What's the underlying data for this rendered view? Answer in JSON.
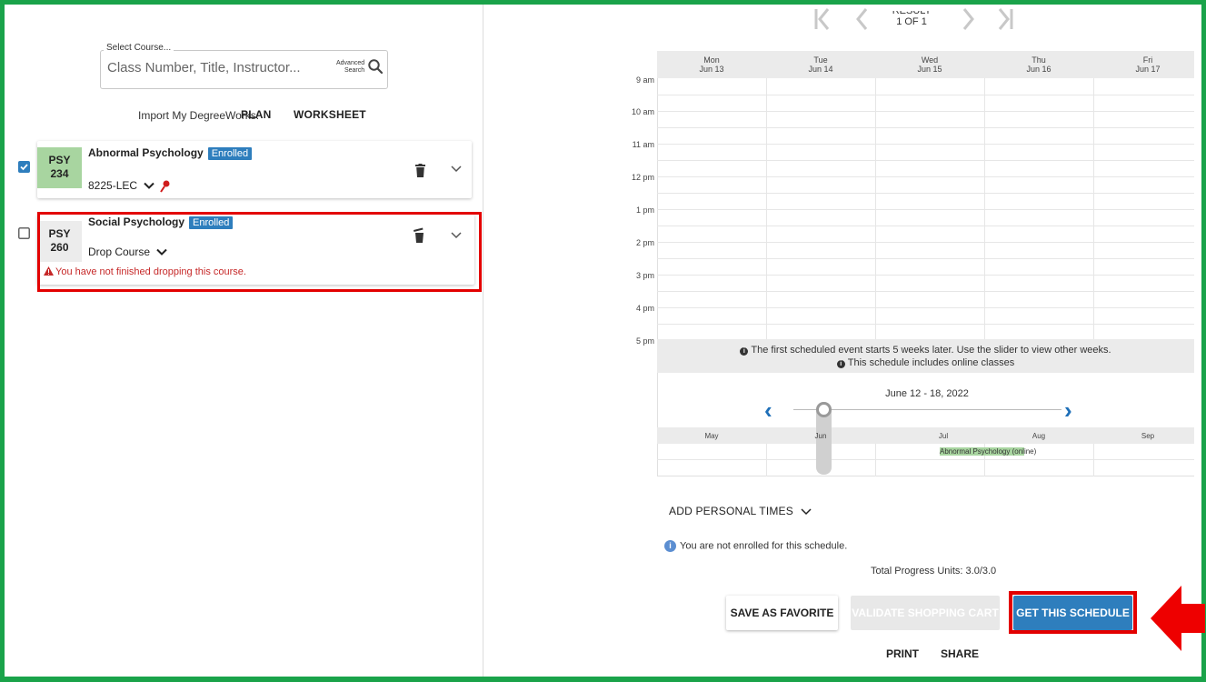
{
  "search": {
    "legend": "Select Course...",
    "placeholder": "Class Number, Title, Instructor...",
    "advanced_line1": "Advanced",
    "advanced_line2": "Search"
  },
  "import": {
    "label": "Import My DegreeWorks:",
    "plan": "PLAN",
    "worksheet": "WORKSHEET"
  },
  "courses": [
    {
      "subject": "PSY",
      "number": "234",
      "title": "Abnormal Psychology",
      "badge": "Enrolled",
      "section": "8225-LEC",
      "checked": true
    },
    {
      "subject": "PSY",
      "number": "260",
      "title": "Social Psychology",
      "badge": "Enrolled",
      "section": "Drop Course",
      "checked": false,
      "warning": "You have not finished dropping this course."
    }
  ],
  "pager": {
    "line1": "RESULT",
    "line2": "1 OF 1"
  },
  "calendar": {
    "days": [
      {
        "dow": "Mon",
        "date": "Jun 13"
      },
      {
        "dow": "Tue",
        "date": "Jun 14"
      },
      {
        "dow": "Wed",
        "date": "Jun 15"
      },
      {
        "dow": "Thu",
        "date": "Jun 16"
      },
      {
        "dow": "Fri",
        "date": "Jun 17"
      }
    ],
    "times": [
      "9 am",
      "10 am",
      "11 am",
      "12 pm",
      "1 pm",
      "2 pm",
      "3 pm",
      "4 pm",
      "5 pm"
    ],
    "notice_line1": "The first scheduled event starts 5 weeks later. Use the slider to view other weeks.",
    "notice_line2": "This schedule includes online classes",
    "week_range": "June 12 - 18, 2022",
    "months": [
      "May",
      "Jun",
      "Jul",
      "Aug",
      "Sep"
    ],
    "online_course_a": "Abnormal Psychology (onl",
    "online_course_b": "ine)"
  },
  "personal_times": "ADD PERSONAL TIMES",
  "info_text": "You are not enrolled for this schedule.",
  "units_text": "Total Progress Units: 3.0/3.0",
  "buttons": {
    "favorite": "SAVE AS FAVORITE",
    "validate": "VALIDATE SHOPPING CART",
    "get": "GET THIS SCHEDULE"
  },
  "links": {
    "print": "PRINT",
    "share": "SHARE"
  },
  "colors": {
    "frame": "#1aa34a",
    "highlight": "#e30000",
    "badge": "#2e7ebd",
    "code_box_enrolled": "#a8d5a0"
  }
}
